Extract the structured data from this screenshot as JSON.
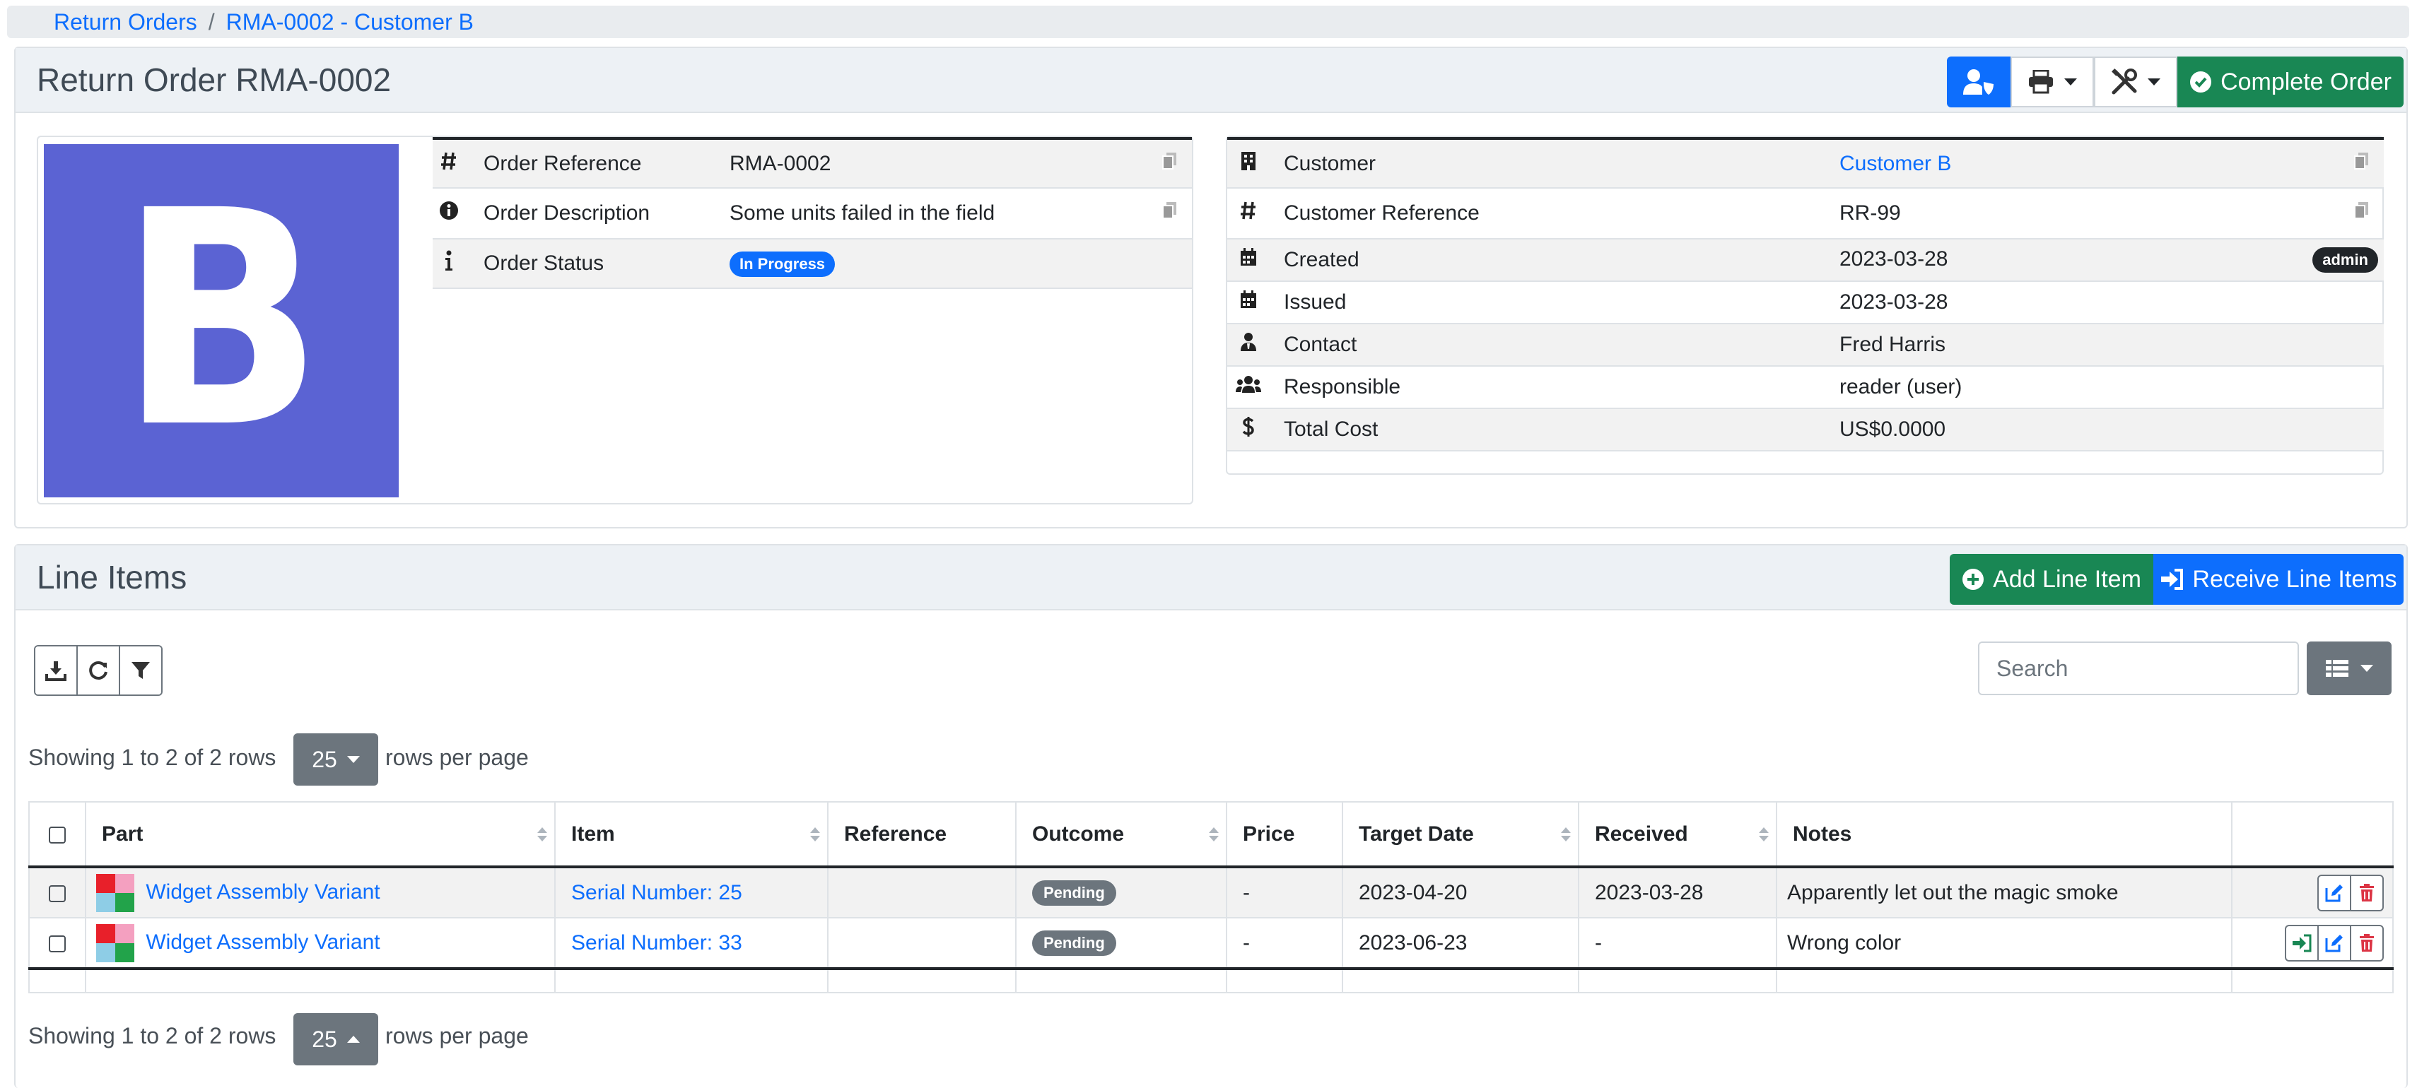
{
  "breadcrumb": {
    "items": [
      "Return Orders",
      "RMA-0002 - Customer B"
    ],
    "separator": "/"
  },
  "order_panel": {
    "title": "Return Order RMA-0002",
    "actions": {
      "assign": "user-shield-icon",
      "print": "print-icon",
      "tools": "tools-icon",
      "complete_label": "Complete Order"
    },
    "thumbnail_letter": "B",
    "left_rows": [
      {
        "icon": "hash-icon",
        "label": "Order Reference",
        "value": "RMA-0002"
      },
      {
        "icon": "info-circle-icon",
        "label": "Order Description",
        "value": "Some units failed in the field"
      },
      {
        "icon": "info-icon",
        "label": "Order Status",
        "value": "In Progress"
      }
    ],
    "right_rows": [
      {
        "icon": "building-icon",
        "label": "Customer",
        "value": "Customer B"
      },
      {
        "icon": "hash-icon",
        "label": "Customer Reference",
        "value": "RR-99"
      },
      {
        "icon": "calendar-icon",
        "label": "Created",
        "value": "2023-03-28",
        "badge": "admin"
      },
      {
        "icon": "calendar-icon",
        "label": "Issued",
        "value": "2023-03-28"
      },
      {
        "icon": "user-tie-icon",
        "label": "Contact",
        "value": "Fred Harris"
      },
      {
        "icon": "users-icon",
        "label": "Responsible",
        "value": "reader (user)"
      },
      {
        "icon": "dollar-icon",
        "label": "Total Cost",
        "value": "US$0.0000"
      }
    ]
  },
  "line_items": {
    "title": "Line Items",
    "add_label": "Add Line Item",
    "receive_label": "Receive Line Items",
    "search_placeholder": "Search",
    "pagination": {
      "showing": "Showing 1 to 2 of 2 rows",
      "page_size": "25",
      "suffix": "rows per page"
    },
    "columns": [
      "Part",
      "Item",
      "Reference",
      "Outcome",
      "Price",
      "Target Date",
      "Received",
      "Notes"
    ],
    "rows": [
      {
        "part": "Widget Assembly Variant",
        "item": "Serial Number: 25",
        "reference": "",
        "outcome": "Pending",
        "price": "-",
        "target_date": "2023-04-20",
        "received": "2023-03-28",
        "notes": "Apparently let out the magic smoke"
      },
      {
        "part": "Widget Assembly Variant",
        "item": "Serial Number: 33",
        "reference": "",
        "outcome": "Pending",
        "price": "-",
        "target_date": "2023-06-23",
        "received": "-",
        "notes": "Wrong color"
      }
    ]
  },
  "colors": {
    "primary": "#0d6efd",
    "success": "#198754",
    "secondary": "#6c757d",
    "thumbnail": "#5b63d3"
  }
}
